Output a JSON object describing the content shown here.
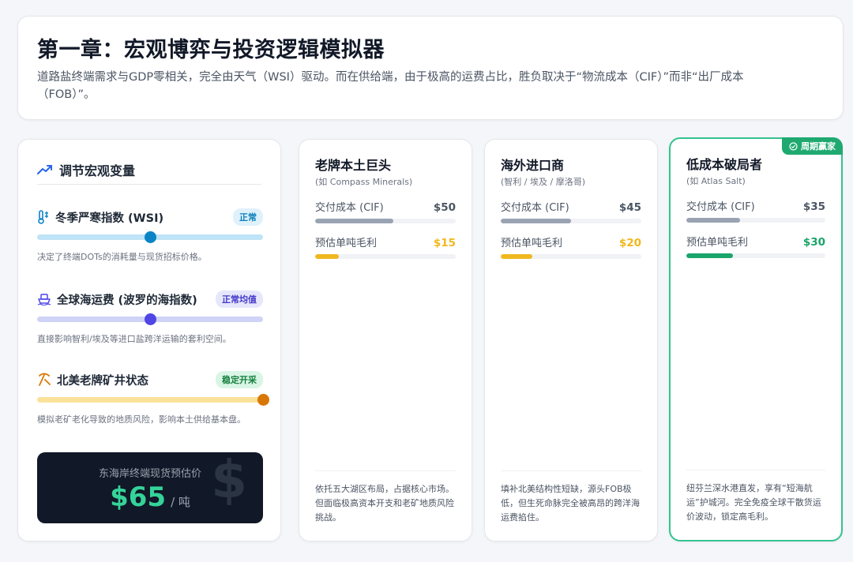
{
  "header": {
    "title": "第一章：宏观博弈与投资逻辑模拟器",
    "subtitle": "道路盐终端需求与GDP零相关，完全由天气（WSI）驱动。而在供给端，由于极高的运费占比，胜负取决于“物流成本（CIF）”而非“出厂成本（FOB）”。"
  },
  "panel": {
    "title": "调节宏观变量",
    "title_icon": "trend-up-icon",
    "variables": [
      {
        "icon": "thermometer-icon",
        "name": "冬季严寒指数 (WSI)",
        "badge": "正常",
        "level": 0.5,
        "desc": "决定了终端DOTs的消耗量与现货招标价格。",
        "track_color": "#bfe3f7",
        "knob_color": "#0b84c6",
        "badge_bg": "#dff1fb",
        "badge_fg": "#0b7fbd"
      },
      {
        "icon": "ship-icon",
        "name": "全球海运费 (波罗的海指数)",
        "badge": "正常均值",
        "level": 0.5,
        "desc": "直接影响智利/埃及等进口盐跨洋运输的套利空间。",
        "track_color": "#cfd3f6",
        "knob_color": "#4f46e5",
        "badge_bg": "#e6e7fb",
        "badge_fg": "#4338ca"
      },
      {
        "icon": "pickaxe-icon",
        "name": "北美老牌矿井状态",
        "badge": "稳定开采",
        "level": 1.0,
        "desc": "模拟老矿老化导致的地质风险，影响本土供给基本盘。",
        "track_color": "#fbe29a",
        "knob_color": "#d97706",
        "badge_bg": "#d9f5e6",
        "badge_fg": "#15803d"
      }
    ],
    "price": {
      "label": "东海岸终端现货预估价",
      "value": "$65",
      "unit": "/ 吨",
      "icon": "dollar-icon"
    }
  },
  "companies": [
    {
      "name": "老牌本土巨头",
      "sub": "(如 Compass Minerals)",
      "cost_label": "交付成本 (CIF)",
      "cost_value": "$50",
      "cost_num": 50,
      "margin_label": "预估单吨毛利",
      "margin_value": "$15",
      "margin_num": 15,
      "margin_color": "#f0b820",
      "desc": "依托五大湖区布局，占据核心市场。但面临极高资本开支和老矿地质风险挑战。"
    },
    {
      "name": "海外进口商",
      "sub": "(智利 / 埃及 / 摩洛哥)",
      "cost_label": "交付成本 (CIF)",
      "cost_value": "$45",
      "cost_num": 45,
      "margin_label": "预估单吨毛利",
      "margin_value": "$20",
      "margin_num": 20,
      "margin_color": "#f0b820",
      "desc": "填补北美结构性短缺，源头FOB极低，但生死命脉完全被高昂的跨洋海运费掐住。"
    },
    {
      "name": "低成本破局者",
      "sub": "(如 Atlas Salt)",
      "cost_label": "交付成本 (CIF)",
      "cost_value": "$35",
      "cost_num": 35,
      "margin_label": "预估单吨毛利",
      "margin_value": "$30",
      "margin_num": 30,
      "margin_color": "#1aa56a",
      "winner": "周期赢家",
      "desc": "纽芬兰深水港直发，享有“短海航运”护城河。完全免疫全球干散货运价波动，锁定高毛利。"
    }
  ],
  "bar_max": 90
}
